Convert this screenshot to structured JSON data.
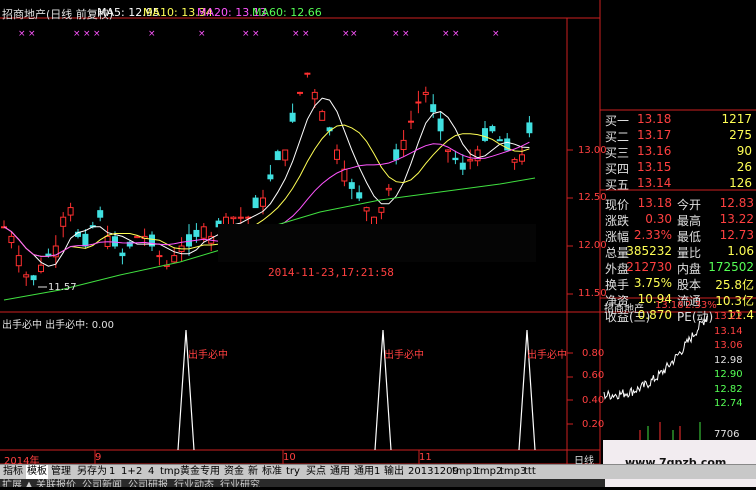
{
  "header": {
    "title": "招商地产(日线 前复权)",
    "ma": [
      {
        "label": "MA5: 12.95",
        "color": "#ffffff"
      },
      {
        "label": "MA10: 13.34",
        "color": "#ffff55"
      },
      {
        "label": "MA20: 13.13",
        "color": "#ff55ff"
      },
      {
        "label": "MA60: 12.66",
        "color": "#55ff55"
      }
    ]
  },
  "price_axis": [
    "13.00",
    "12.50",
    "12.00",
    "11.50"
  ],
  "low_marker": "11.57",
  "timestamp": "2014-11-23,17:21:58",
  "indicator": {
    "title": "出手必中  出手必中: 0.00",
    "signal_label": "出手必中",
    "axis": [
      "0.80",
      "0.60",
      "0.40",
      "0.20"
    ]
  },
  "months": [
    "2014年",
    "9",
    "10",
    "11"
  ],
  "info": {
    "bids": [
      {
        "label": "买一",
        "price": "13.18",
        "vol": "1217"
      },
      {
        "label": "买二",
        "price": "13.17",
        "vol": "275"
      },
      {
        "label": "买三",
        "price": "13.16",
        "vol": "90"
      },
      {
        "label": "买四",
        "price": "13.15",
        "vol": "26"
      },
      {
        "label": "买五",
        "price": "13.14",
        "vol": "126"
      }
    ],
    "stats": [
      {
        "l1": "现价",
        "v1": "13.18",
        "l2": "今开",
        "v2": "12.83"
      },
      {
        "l1": "涨跌",
        "v1": "0.30",
        "l2": "最高",
        "v2": "13.22"
      },
      {
        "l1": "涨幅",
        "v1": "2.33%",
        "l2": "最低",
        "v2": "12.73"
      },
      {
        "l1": "总量",
        "v1": "385232",
        "l2": "量比",
        "v2": "1.06"
      },
      {
        "l1": "外盘",
        "v1": "212730",
        "l2": "内盘",
        "v2": "172502"
      },
      {
        "l1": "换手",
        "v1": "3.75%",
        "l2": "股本",
        "v2": "25.8亿"
      },
      {
        "l1": "净资",
        "v1": "10.94",
        "l2": "流通",
        "v2": "10.3亿"
      },
      {
        "l1": "收益(三)",
        "v1": "0.870",
        "l2": "PE(动)",
        "v2": "11.4"
      }
    ]
  },
  "mini": {
    "name": "招商地产",
    "price": "13.18",
    "pct": "2.33%",
    "axis": [
      "13.22",
      "13.14",
      "13.06",
      "12.98",
      "12.90",
      "12.82",
      "12.74"
    ],
    "vol": "7706"
  },
  "period_tab": "日线",
  "watermark": "www.7gpzb.com",
  "tabs": [
    "指标",
    "模板",
    "管理",
    "另存为",
    "1",
    "1+",
    "2",
    "4",
    "tmp",
    "黄金专用",
    "资金",
    "新",
    "标准",
    "try",
    "买点",
    "通用",
    "通用1",
    "输出",
    "20131209",
    "tmp1",
    "tmp2",
    "tmp3",
    "ttt"
  ],
  "tabs2": [
    "扩展 ▲",
    "关联报价",
    "公司新闻",
    "公司研报",
    "行业动态",
    "行业研究"
  ]
}
